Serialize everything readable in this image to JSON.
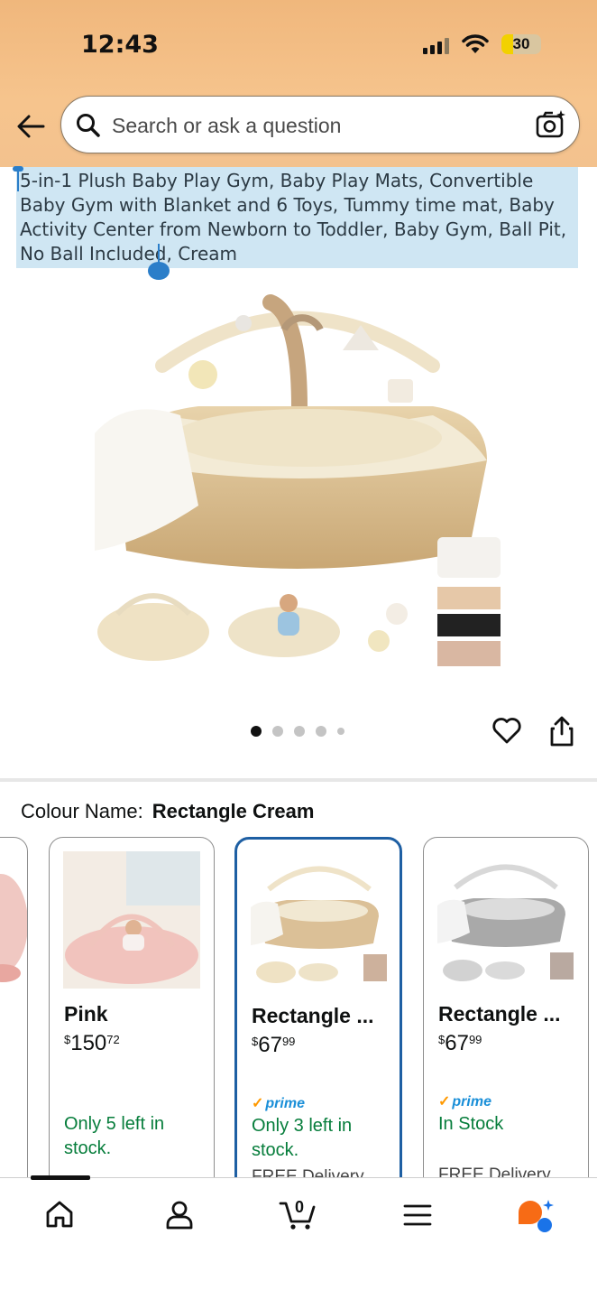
{
  "status_bar": {
    "time": "12:43",
    "battery": "30",
    "battery_percent": 30
  },
  "search": {
    "placeholder": "Search or ask a question"
  },
  "product": {
    "title": "5-in-1 Plush Baby Play Gym, Baby Play Mats, Convertible Baby Gym with Blanket and 6 Toys, Tummy time mat, Baby Activity Center from Newborn to Toddler, Baby Gym, Ball Pit, No Ball Included, Cream"
  },
  "gallery": {
    "dot_count": 5,
    "active_index": 0
  },
  "colour": {
    "label": "Colour Name:",
    "value": "Rectangle Cream"
  },
  "variants": [
    {
      "name": "Pink",
      "price_symbol": "$",
      "price_whole": "150",
      "price_fraction": "72",
      "prime": false,
      "stock": "Only 5 left in stock.",
      "delivery": ""
    },
    {
      "name": "Rectangle ...",
      "price_symbol": "$",
      "price_whole": "67",
      "price_fraction": "99",
      "prime": true,
      "prime_label": "prime",
      "stock": "Only 3 left in stock.",
      "delivery": "FREE Delivery",
      "selected": true
    },
    {
      "name": "Rectangle ...",
      "price_symbol": "$",
      "price_whole": "67",
      "price_fraction": "99",
      "prime": true,
      "prime_label": "prime",
      "stock": "In Stock",
      "delivery": "FREE Delivery"
    }
  ],
  "bottom_nav": {
    "cart_count": "0",
    "items": [
      "home-icon",
      "account-icon",
      "cart-icon",
      "menu-icon",
      "rufus-icon"
    ]
  },
  "colors": {
    "header": "#f3c28e",
    "selection": "#cfe6f3",
    "selected_border": "#1e5fa3",
    "stock_green": "#067d3b",
    "prime_blue": "#1a8fd8"
  }
}
